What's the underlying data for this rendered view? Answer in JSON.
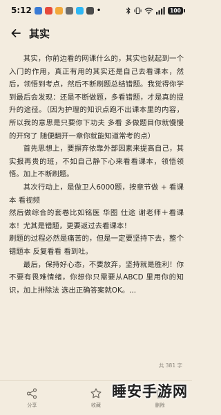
{
  "status_bar": {
    "time": "5:12",
    "battery_level": "100",
    "battery_fraction": 1.0
  },
  "header": {
    "title": "其实"
  },
  "article": {
    "paragraphs": [
      "其实，你前边看的网课什么的，其实也就起到一个入门的作用，真正有用的其实还是自己去看课本，然后，领悟到考点，然后不断刷题总结错题。我觉得你学到最后会发现：还是不断做题，多看错题，才是真的提升的途径。（因为护理的知识点跑不出课本里的内容，所以我的意思是只要你下功夫 多看 多做题目你就慢慢的开窍了 随便翻开一章你就能知道常考的点）",
      "首先思想上，要摒弃依靠外部因素来提高自己，其实报再贵的班，不如自己静下心来看看课本，领悟领悟。加上不断刷题。",
      "其次行动上，是做卫人6000题，按章节做 + 看课本 看视频",
      "然后做综合的套卷比如铭医 华图 仕途 谢老师＋看课本！尤其是错题，更要返过去看课本！",
      "刷题的过程必然是痛苦的，但是一定要坚持下去，整个错题本 反复看看 看到吐。",
      "最后，保持好心态，不要放弃，坚持就是胜利！你不要有畏难情绪，你想你只需要从ABCD 里用你的知识，加上排除法 选出正确答案就OK。..."
    ],
    "word_count": "共 381 字"
  },
  "bottom_bar": {
    "share_label": "分享",
    "favorite_label": "收藏",
    "delete_label": "删除"
  },
  "watermark": {
    "text": "睡安手游网"
  }
}
